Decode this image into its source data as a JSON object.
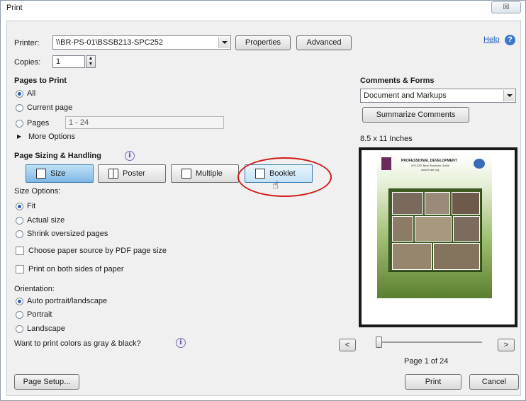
{
  "window": {
    "title": "Print",
    "close_glyph": "☒"
  },
  "printer": {
    "label": "Printer:",
    "value": "\\\\BR-PS-01\\BSSB213-SPC252",
    "properties_label": "Properties",
    "advanced_label": "Advanced"
  },
  "help": {
    "label": "Help",
    "icon": "help-circle-icon"
  },
  "copies": {
    "label": "Copies:",
    "value": "1"
  },
  "pages_to_print": {
    "heading": "Pages to Print",
    "options": [
      "All",
      "Current page",
      "Pages"
    ],
    "selected": "All",
    "range_value": "1 - 24",
    "more_options": "More Options"
  },
  "sizing": {
    "heading": "Page Sizing & Handling",
    "buttons": [
      "Size",
      "Poster",
      "Multiple",
      "Booklet"
    ],
    "active": "Size",
    "size_options_label": "Size Options:",
    "size_options": [
      "Fit",
      "Actual size",
      "Shrink oversized pages"
    ],
    "size_selected": "Fit",
    "choose_paper": "Choose paper source by PDF page size",
    "both_sides": "Print on both sides of paper"
  },
  "orientation": {
    "label": "Orientation:",
    "options": [
      "Auto portrait/landscape",
      "Portrait",
      "Landscape"
    ],
    "selected": "Auto portrait/landscape"
  },
  "gray_question": "Want to print colors as gray & black?",
  "comments_forms": {
    "heading": "Comments & Forms",
    "value": "Document and Markups",
    "summarize_label": "Summarize Comments"
  },
  "preview": {
    "paper_size": "8.5 x 11 Inches",
    "doc_title": "PROFESSIONAL DEVELOPMENT",
    "doc_subtitle": "a FLATE Best Practices Guide",
    "doc_url": "www.fl-ate.org",
    "prev_glyph": "<",
    "next_glyph": ">",
    "page_indicator": "Page 1 of 24",
    "current_page": 1,
    "total_pages": 24
  },
  "footer": {
    "page_setup_label": "Page Setup...",
    "print_label": "Print",
    "cancel_label": "Cancel"
  },
  "colors": {
    "accent": "#2a5fb0",
    "highlight_circle": "#d11a1a",
    "active_button": "#7fb8e6"
  }
}
